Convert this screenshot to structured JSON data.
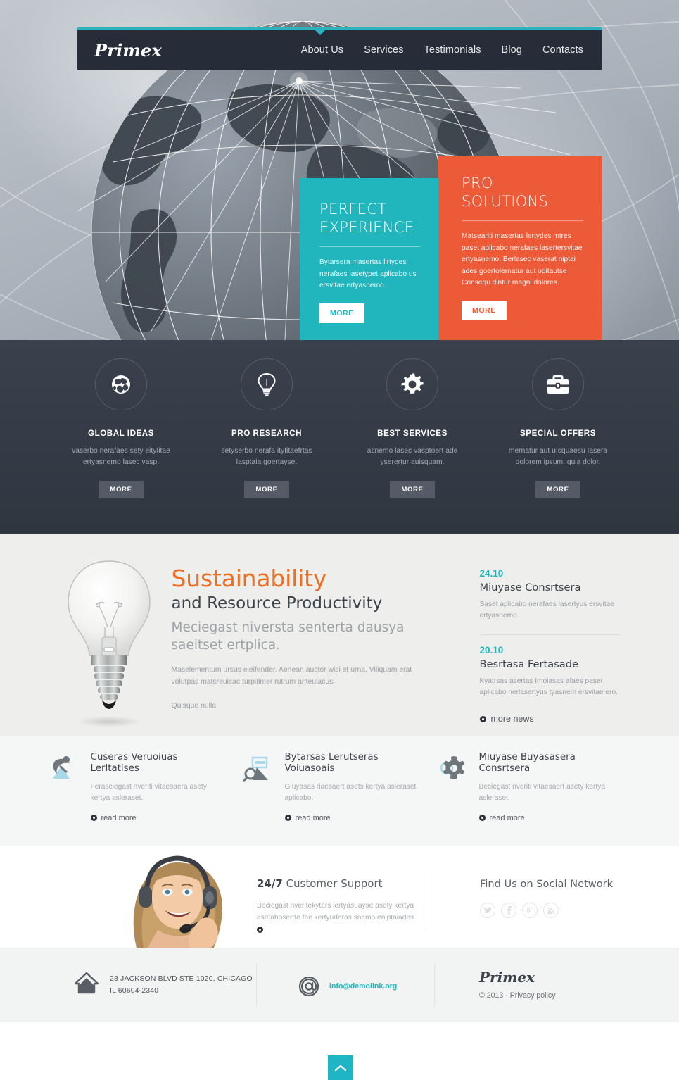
{
  "header": {
    "logo": "Primex",
    "nav": [
      {
        "label": "About Us"
      },
      {
        "label": "Services"
      },
      {
        "label": "Testimonials"
      },
      {
        "label": "Blog"
      },
      {
        "label": "Contacts"
      }
    ]
  },
  "hero": {
    "teal_panel": {
      "title_line1": "PERFECT",
      "title_line2": "EXPERIENCE",
      "text": "Bytarsera masertas lirtydes nerafaes lasetypet aplicabo us ersvitae ertyasnemo.",
      "button": "MORE",
      "color": "#21b6bd"
    },
    "orange_panel": {
      "title_line1": "PRO",
      "title_line2": "SOLUTIONS",
      "text": "Matseariti masertas lertydes mtres paset aplicabo nerafaes lasertersvitae ertyasnemo. Berlasec vaserat niptai ades goertolernatur aut oditautse Consequ dintur magni dolores.",
      "button": "MORE",
      "color": "#ec5a38"
    }
  },
  "features": [
    {
      "icon": "globe-icon",
      "title": "GLOBAL IDEAS",
      "desc": "vaserbo nerafaes sety eityIitae ertyasnemo lasec vasp.",
      "button": "MORE"
    },
    {
      "icon": "lightbulb-icon",
      "title": "PRO RESEARCH",
      "desc": "setyserbo nerafa ityIitaefrtas lasptaia goertayse.",
      "button": "MORE"
    },
    {
      "icon": "gear-icon",
      "title": "BEST SERVICES",
      "desc": "asnemo lasec vasptoert ade yserertur auisquam.",
      "button": "MORE"
    },
    {
      "icon": "briefcase-icon",
      "title": "SPECIAL OFFERS",
      "desc": "mernatur aut uIsquaesu Iasera dolorem ipsum, quia dolor.",
      "button": "MORE"
    }
  ],
  "sustainability": {
    "image_alt": "lightbulb-photo",
    "heading_accent": "Sustainability",
    "heading_rest": "and Resource Productivity",
    "subheading": "Meciegast niversta senterta dausya saeitset ertplica.",
    "paragraph": "Maselementum ursus eleifender. Aenean auctor wisi et urna. Viliquam erat volutpas matsreuisac turpiIinter rutrum anteulacus.",
    "paragraph2": "Quisque nulla.",
    "accent_color": "#ee6f23"
  },
  "news": {
    "items": [
      {
        "date": "24.10",
        "title": "Miuyase Consrtsera",
        "text": "Saset aplicabo nerafaes lasertyus ersvitae ertyasnemo."
      },
      {
        "date": "20.10",
        "title": "Besrtasa Fertasade",
        "text": "Kyatrsas asertas Imoiasas afaes paset aplicabo nerlasertyus tyasnem ersvitae ero."
      }
    ],
    "more_label": "more news",
    "date_color": "#22b4bc"
  },
  "services3": [
    {
      "icon": "satellite-dish-icon",
      "title": "Cuseras Veruoiuas Lerltatises",
      "text": "Ferasciegast nveriti vitaesaera asety kertya asleraset.",
      "link": "read more"
    },
    {
      "icon": "document-search-icon",
      "title": "Bytarsas Lerutseras Voiuasoais",
      "text": "Giuyasas riaesaert asets kertya asleraset aplicabo.",
      "link": "read more"
    },
    {
      "icon": "gears-icon",
      "title": "Miuyase Buyasasera Consrtsera",
      "text": "Beciegast nveriti vitaesaert asety kertya asleraset.",
      "link": "read more"
    }
  ],
  "support": {
    "photo_alt": "support-agent-photo",
    "title_bold": "24/7",
    "title_rest": " Customer Support",
    "text": "Beciegast nveritekytars lertyasuayse asety kertya asetaboserde fae kertyuderas snemo eniptaiades",
    "social_title": "Find Us on Social Network",
    "social": [
      {
        "name": "twitter-icon",
        "glyph": "t"
      },
      {
        "name": "facebook-icon",
        "glyph": "f"
      },
      {
        "name": "google-plus-icon",
        "glyph": "g+"
      },
      {
        "name": "rss-icon",
        "glyph": "rss"
      }
    ]
  },
  "footer": {
    "address_line1": "28 JACKSON BLVD STE 1020, CHICAGO",
    "address_line2": "IL 60604-2340",
    "email": "info@demolink.org",
    "logo": "Primex",
    "copyright": "© 2013 · Privacy policy",
    "email_color": "#22b4bc"
  },
  "back_to_top": {
    "name": "back-to-top-button",
    "color": "#1fb5c4"
  }
}
